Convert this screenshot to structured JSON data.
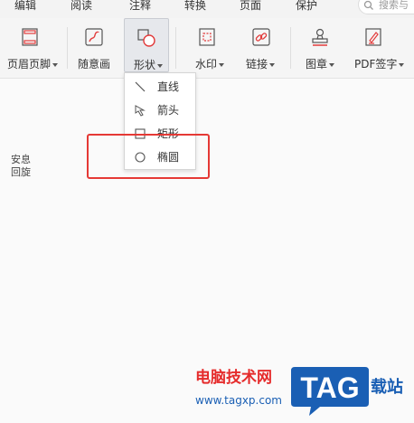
{
  "menubar": {
    "items": [
      "编辑",
      "阅读",
      "注释",
      "转换",
      "页面",
      "保护"
    ],
    "search_placeholder": "搜索与"
  },
  "toolbar": {
    "tools": [
      {
        "label": "页眉页脚",
        "icon": "header-footer-icon",
        "dropdown": true
      },
      {
        "label": "随意画",
        "icon": "freehand-draw-icon",
        "dropdown": false
      },
      {
        "label": "形状",
        "icon": "shape-icon",
        "dropdown": true,
        "active": true
      },
      {
        "label": "水印",
        "icon": "watermark-icon",
        "dropdown": true
      },
      {
        "label": "链接",
        "icon": "link-icon",
        "dropdown": true
      },
      {
        "label": "图章",
        "icon": "stamp-icon",
        "dropdown": true
      },
      {
        "label": "PDF签字",
        "icon": "pdf-sign-icon",
        "dropdown": true
      }
    ]
  },
  "shape_dropdown": {
    "items": [
      {
        "label": "直线",
        "icon": "line-icon"
      },
      {
        "label": "箭头",
        "icon": "arrow-icon"
      },
      {
        "label": "矩形",
        "icon": "rectangle-icon"
      },
      {
        "label": "椭圆",
        "icon": "ellipse-icon"
      }
    ]
  },
  "highlight": {
    "color": "#e53935"
  },
  "document": {
    "side_text": [
      "安息",
      "回旋"
    ]
  },
  "watermark": {
    "line1": "电脑技术网",
    "line2": "www.tagxp.com",
    "logo": "TAG",
    "line3": "载站"
  },
  "colors": {
    "accent_red": "#e52b2b",
    "accent_blue": "#1a5fb4"
  }
}
